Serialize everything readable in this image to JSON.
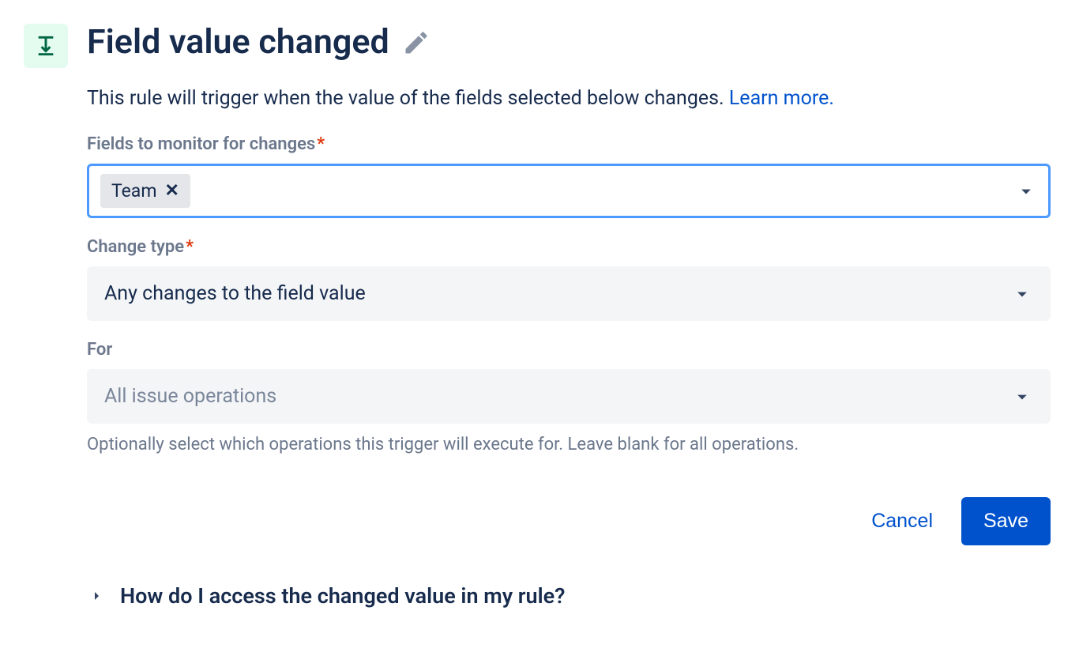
{
  "header": {
    "title": "Field value changed",
    "icon": "trigger-arrow-icon"
  },
  "description": {
    "text": "This rule will trigger when the value of the fields selected below changes. ",
    "learn_more": "Learn more."
  },
  "fields_to_monitor": {
    "label": "Fields to monitor for changes",
    "required": true,
    "tags": [
      {
        "label": "Team"
      }
    ]
  },
  "change_type": {
    "label": "Change type",
    "required": true,
    "value": "Any changes to the field value"
  },
  "for": {
    "label": "For",
    "required": false,
    "placeholder": "All issue operations",
    "help": "Optionally select which operations this trigger will execute for. Leave blank for all operations."
  },
  "actions": {
    "cancel": "Cancel",
    "save": "Save"
  },
  "accordion": {
    "title": "How do I access the changed value in my rule?"
  }
}
